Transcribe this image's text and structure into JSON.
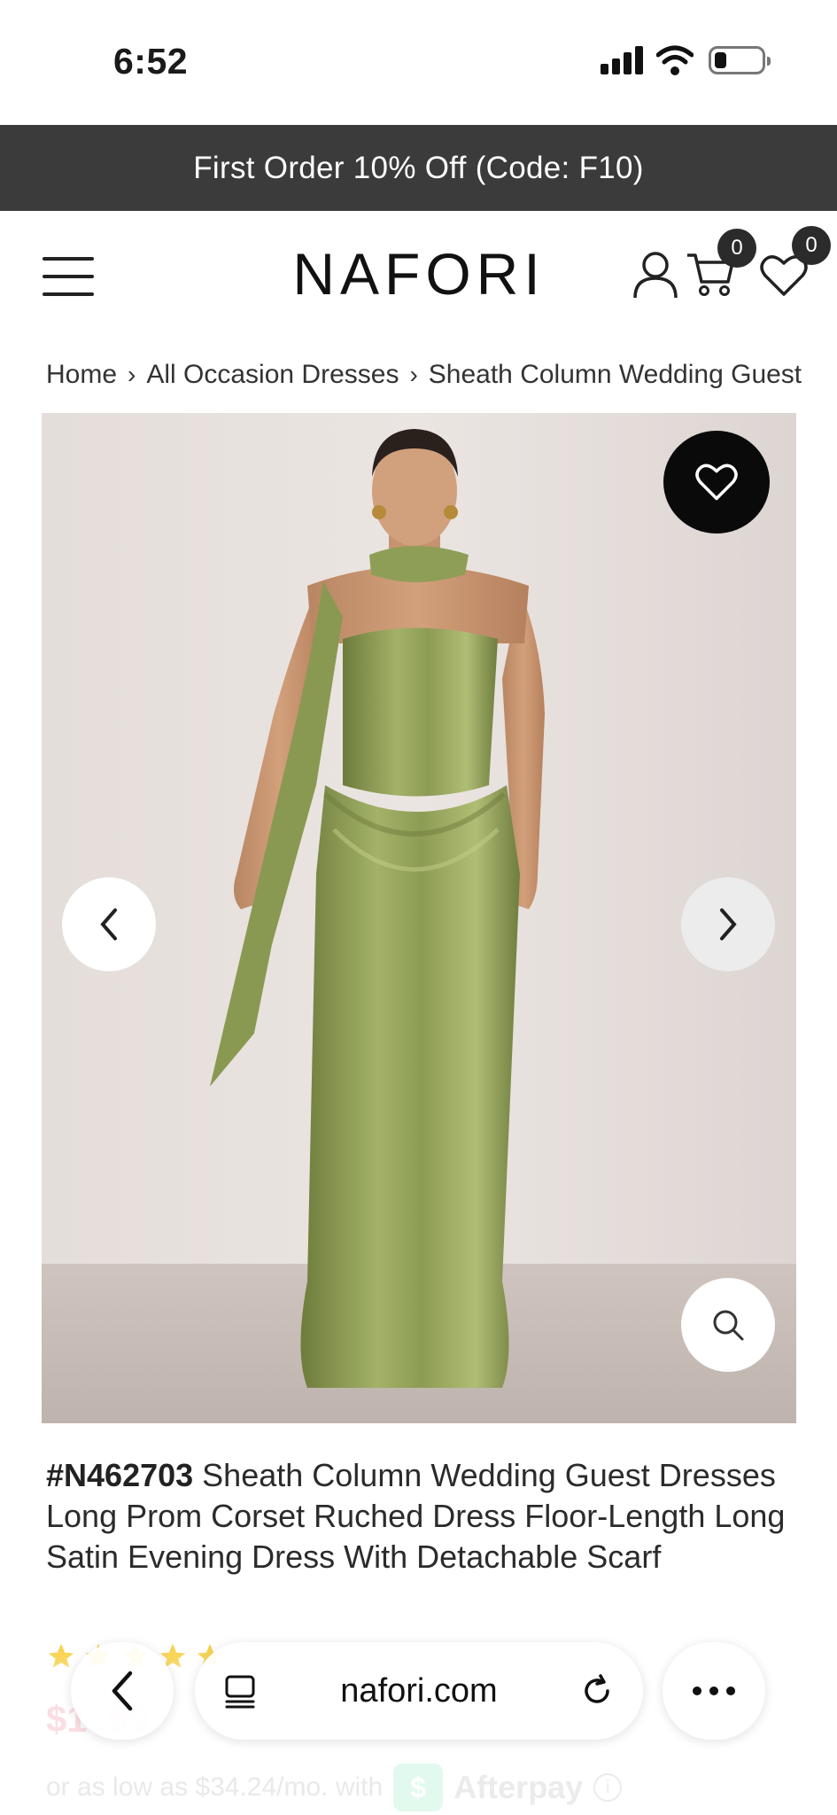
{
  "status_bar": {
    "time": "6:52",
    "signal_icon": "cellular-signal-icon",
    "wifi_icon": "wifi-icon",
    "battery_icon": "battery-low-icon"
  },
  "promo_banner": {
    "text": "First Order 10% Off (Code: F10)"
  },
  "header": {
    "logo": "NAFORI",
    "cart_count": "0",
    "wishlist_count": "0"
  },
  "breadcrumb": {
    "items": [
      "Home",
      "All Occasion Dresses",
      "Sheath Column Wedding Guest"
    ]
  },
  "product": {
    "sku": "#N462703",
    "title": "Sheath Column Wedding Guest Dresses Long Prom Corset Ruched Dress Floor-Length Long Satin Evening Dress With Detachable Scarf",
    "price_partial": "$1  .99",
    "afterpay_text": "or as low as $34.24/mo. with",
    "afterpay_brand": "Afterpay",
    "dress_color": "#8a9a55"
  },
  "browser_bar": {
    "url": "nafori.com"
  }
}
